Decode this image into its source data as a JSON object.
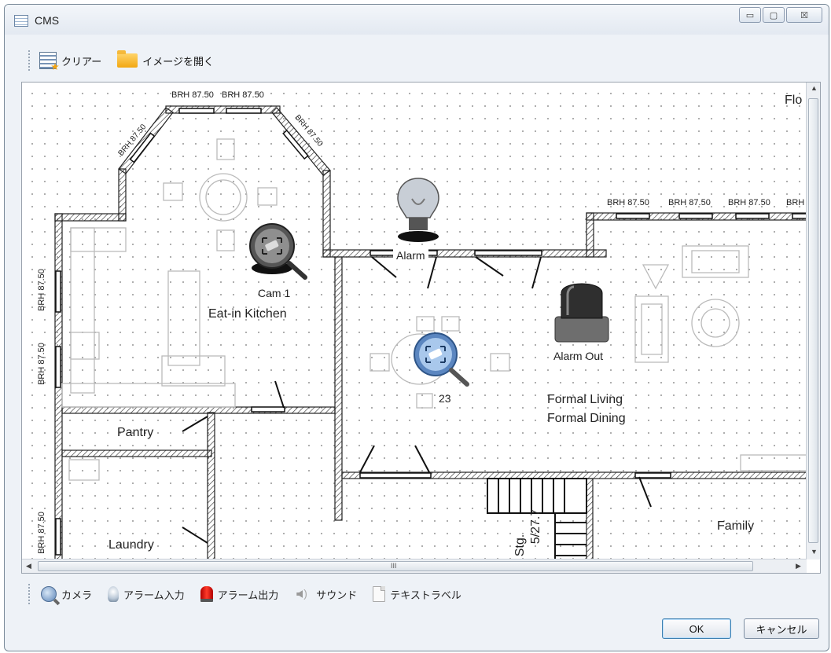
{
  "window": {
    "title": "CMS",
    "minimize_label": "▭",
    "maximize_label": "▢",
    "close_label": "☒"
  },
  "toolbar": {
    "clear_label": "クリアー",
    "open_image_label": "イメージを開く"
  },
  "floorplan": {
    "rooms": {
      "kitchen": "Eat-in Kitchen",
      "pantry": "Pantry",
      "laundry": "Laundry",
      "living": "Formal Living",
      "dining": "Formal Dining",
      "family": "Family",
      "floor_cut": "Flo",
      "stg": "Stg.",
      "stg_dims": "5/27.7"
    },
    "window_labels": {
      "top1": "BRH 87.50",
      "top2": "BRH 87.50",
      "diag_left": "BRH 87.50",
      "diag_right": "BRH 87.50",
      "right1": "BRH 87.50",
      "right2": "BRH 87.50",
      "right3": "BRH 87.50",
      "right4": "BRH",
      "left1": "BRH 87.50",
      "left2": "BRH 87.50",
      "left3": "BRH 87.50"
    },
    "devices": {
      "cam1": "Cam 1",
      "alarm": "Alarm",
      "alarm_out": "Alarm Out",
      "cam23": "23"
    }
  },
  "palette": {
    "camera_label": "カメラ",
    "alarm_in_label": "アラーム入力",
    "alarm_out_label": "アラーム出力",
    "sound_label": "サウンド",
    "text_label_label": "テキストラベル"
  },
  "buttons": {
    "ok_label": "OK",
    "cancel_label": "キャンセル"
  },
  "scroll": {
    "h_grip": "III"
  }
}
